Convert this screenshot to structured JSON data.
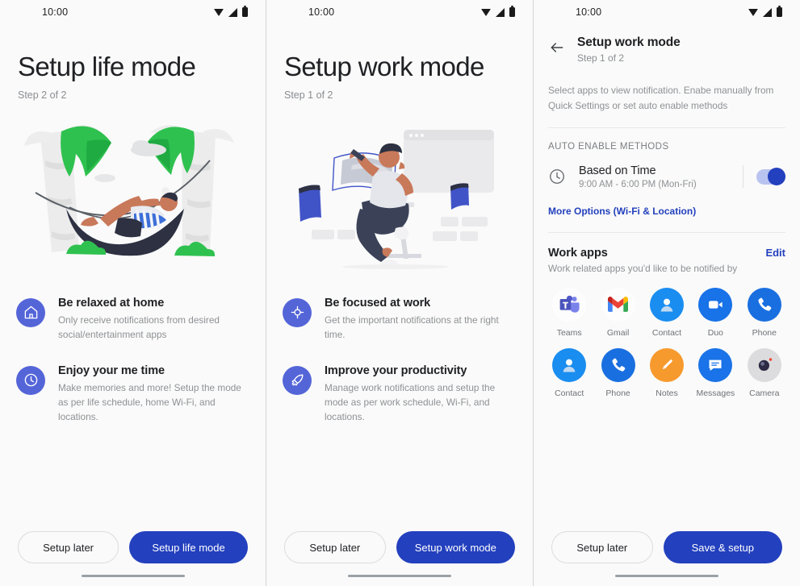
{
  "statusbar": {
    "time": "10:00",
    "icons": [
      "wifi-icon",
      "signal-icon",
      "battery-icon"
    ]
  },
  "colors": {
    "primary_blue": "#2340be",
    "icon_circle_blue": "#5465d8",
    "link_blue": "#2340be",
    "background": "#fafafa",
    "leaf_green": "#2fc14f",
    "trunk_gray": "#eceded"
  },
  "panel_life": {
    "title": "Setup life mode",
    "step": "Step 2 of 2",
    "illustration": "person-relaxing-in-hammock-between-palm-trees",
    "features": [
      {
        "icon": "home-icon",
        "title": "Be relaxed at home",
        "desc": "Only receive notifications from desired social/entertainment apps"
      },
      {
        "icon": "clock-icon",
        "title": "Enjoy your me time",
        "desc": "Make memories and more! Setup the mode as per life schedule, home Wi-Fi, and locations."
      }
    ],
    "secondary_button": "Setup later",
    "primary_button": "Setup life mode"
  },
  "panel_work": {
    "title": "Setup work mode",
    "step": "Step 1 of 2",
    "illustration": "person-sitting-on-stool-working-with-floating-screens",
    "features": [
      {
        "icon": "focus-crosshair-icon",
        "title": "Be focused at work",
        "desc": "Get the important notifications at the right  time."
      },
      {
        "icon": "rocket-icon",
        "title": "Improve your productivity",
        "desc": "Manage work notifications and setup the mode as per work schedule, Wi-Fi, and locations."
      }
    ],
    "secondary_button": "Setup later",
    "primary_button": "Setup work mode"
  },
  "panel_detail": {
    "back_icon": "back-arrow-icon",
    "title": "Setup work mode",
    "step": "Step 1 of 2",
    "description": "Select apps to view notification. Enabe manually from Quick Settings or set auto enable methods",
    "section_label": "AUTO ENABLE METHODS",
    "method": {
      "icon": "clock-icon",
      "title": "Based on Time",
      "subtitle": "9:00 AM - 6:00 PM (Mon-Fri)",
      "toggle_on": true
    },
    "more_options_link": "More Options (Wi-Fi & Location)",
    "apps_section": {
      "title": "Work apps",
      "edit_label": "Edit",
      "subtitle": "Work related apps you'd like to be notified by",
      "apps": [
        {
          "name": "Teams",
          "icon": "teams-icon"
        },
        {
          "name": "Gmail",
          "icon": "gmail-icon"
        },
        {
          "name": "Contact",
          "icon": "contact-icon"
        },
        {
          "name": "Duo",
          "icon": "duo-icon"
        },
        {
          "name": "Phone",
          "icon": "phone-icon"
        },
        {
          "name": "Contact",
          "icon": "contact-icon"
        },
        {
          "name": "Phone",
          "icon": "phone-icon"
        },
        {
          "name": "Notes",
          "icon": "notes-icon"
        },
        {
          "name": "Messages",
          "icon": "messages-icon"
        },
        {
          "name": "Camera",
          "icon": "camera-icon"
        }
      ]
    },
    "secondary_button": "Setup later",
    "primary_button": "Save & setup"
  }
}
